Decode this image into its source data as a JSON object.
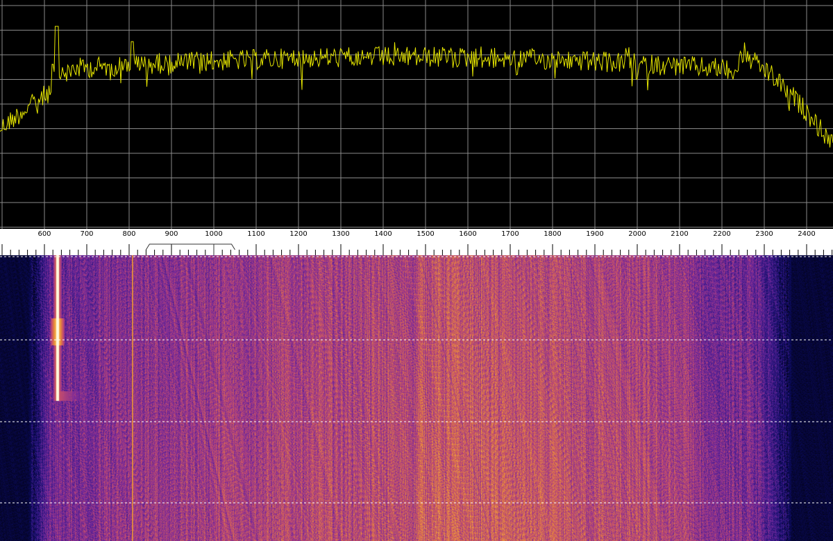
{
  "spectrum": {
    "trace_color": "#e8e800",
    "grid_color": "#8a8a8a",
    "background_color": "#000000",
    "peak_frequency": 630,
    "secondary_marker_frequency": 808
  },
  "frequency_scale": {
    "ticks": [
      {
        "value": 600,
        "label": "600"
      },
      {
        "value": 700,
        "label": "700"
      },
      {
        "value": 800,
        "label": "800"
      },
      {
        "value": 900,
        "label": "900"
      },
      {
        "value": 1000,
        "label": "1000"
      },
      {
        "value": 1100,
        "label": "1100"
      },
      {
        "value": 1200,
        "label": "1200"
      },
      {
        "value": 1300,
        "label": "1300"
      },
      {
        "value": 1400,
        "label": "1400"
      },
      {
        "value": 1500,
        "label": "1500"
      },
      {
        "value": 1600,
        "label": "1600"
      },
      {
        "value": 1700,
        "label": "1700"
      },
      {
        "value": 1800,
        "label": "1800"
      },
      {
        "value": 1900,
        "label": "1900"
      },
      {
        "value": 2000,
        "label": "2000"
      },
      {
        "value": 2100,
        "label": "2100"
      },
      {
        "value": 2200,
        "label": "2200"
      },
      {
        "value": 2300,
        "label": "2300"
      },
      {
        "value": 2400,
        "label": "2400"
      }
    ],
    "visible_range_hz": [
      500,
      2460
    ],
    "filter_passband_hz": [
      840,
      1050
    ],
    "filter_center_hz": 1000
  },
  "waterfall": {
    "palette": [
      "#000000",
      "#0a0a5a",
      "#3a1a8a",
      "#7a2a9a",
      "#c04a70",
      "#e88a3a",
      "#ffd060",
      "#fffff0"
    ],
    "divider_color": "#ffffff",
    "signal_frequency_hz": 630,
    "carrier_line_frequency_hz": 808
  }
}
